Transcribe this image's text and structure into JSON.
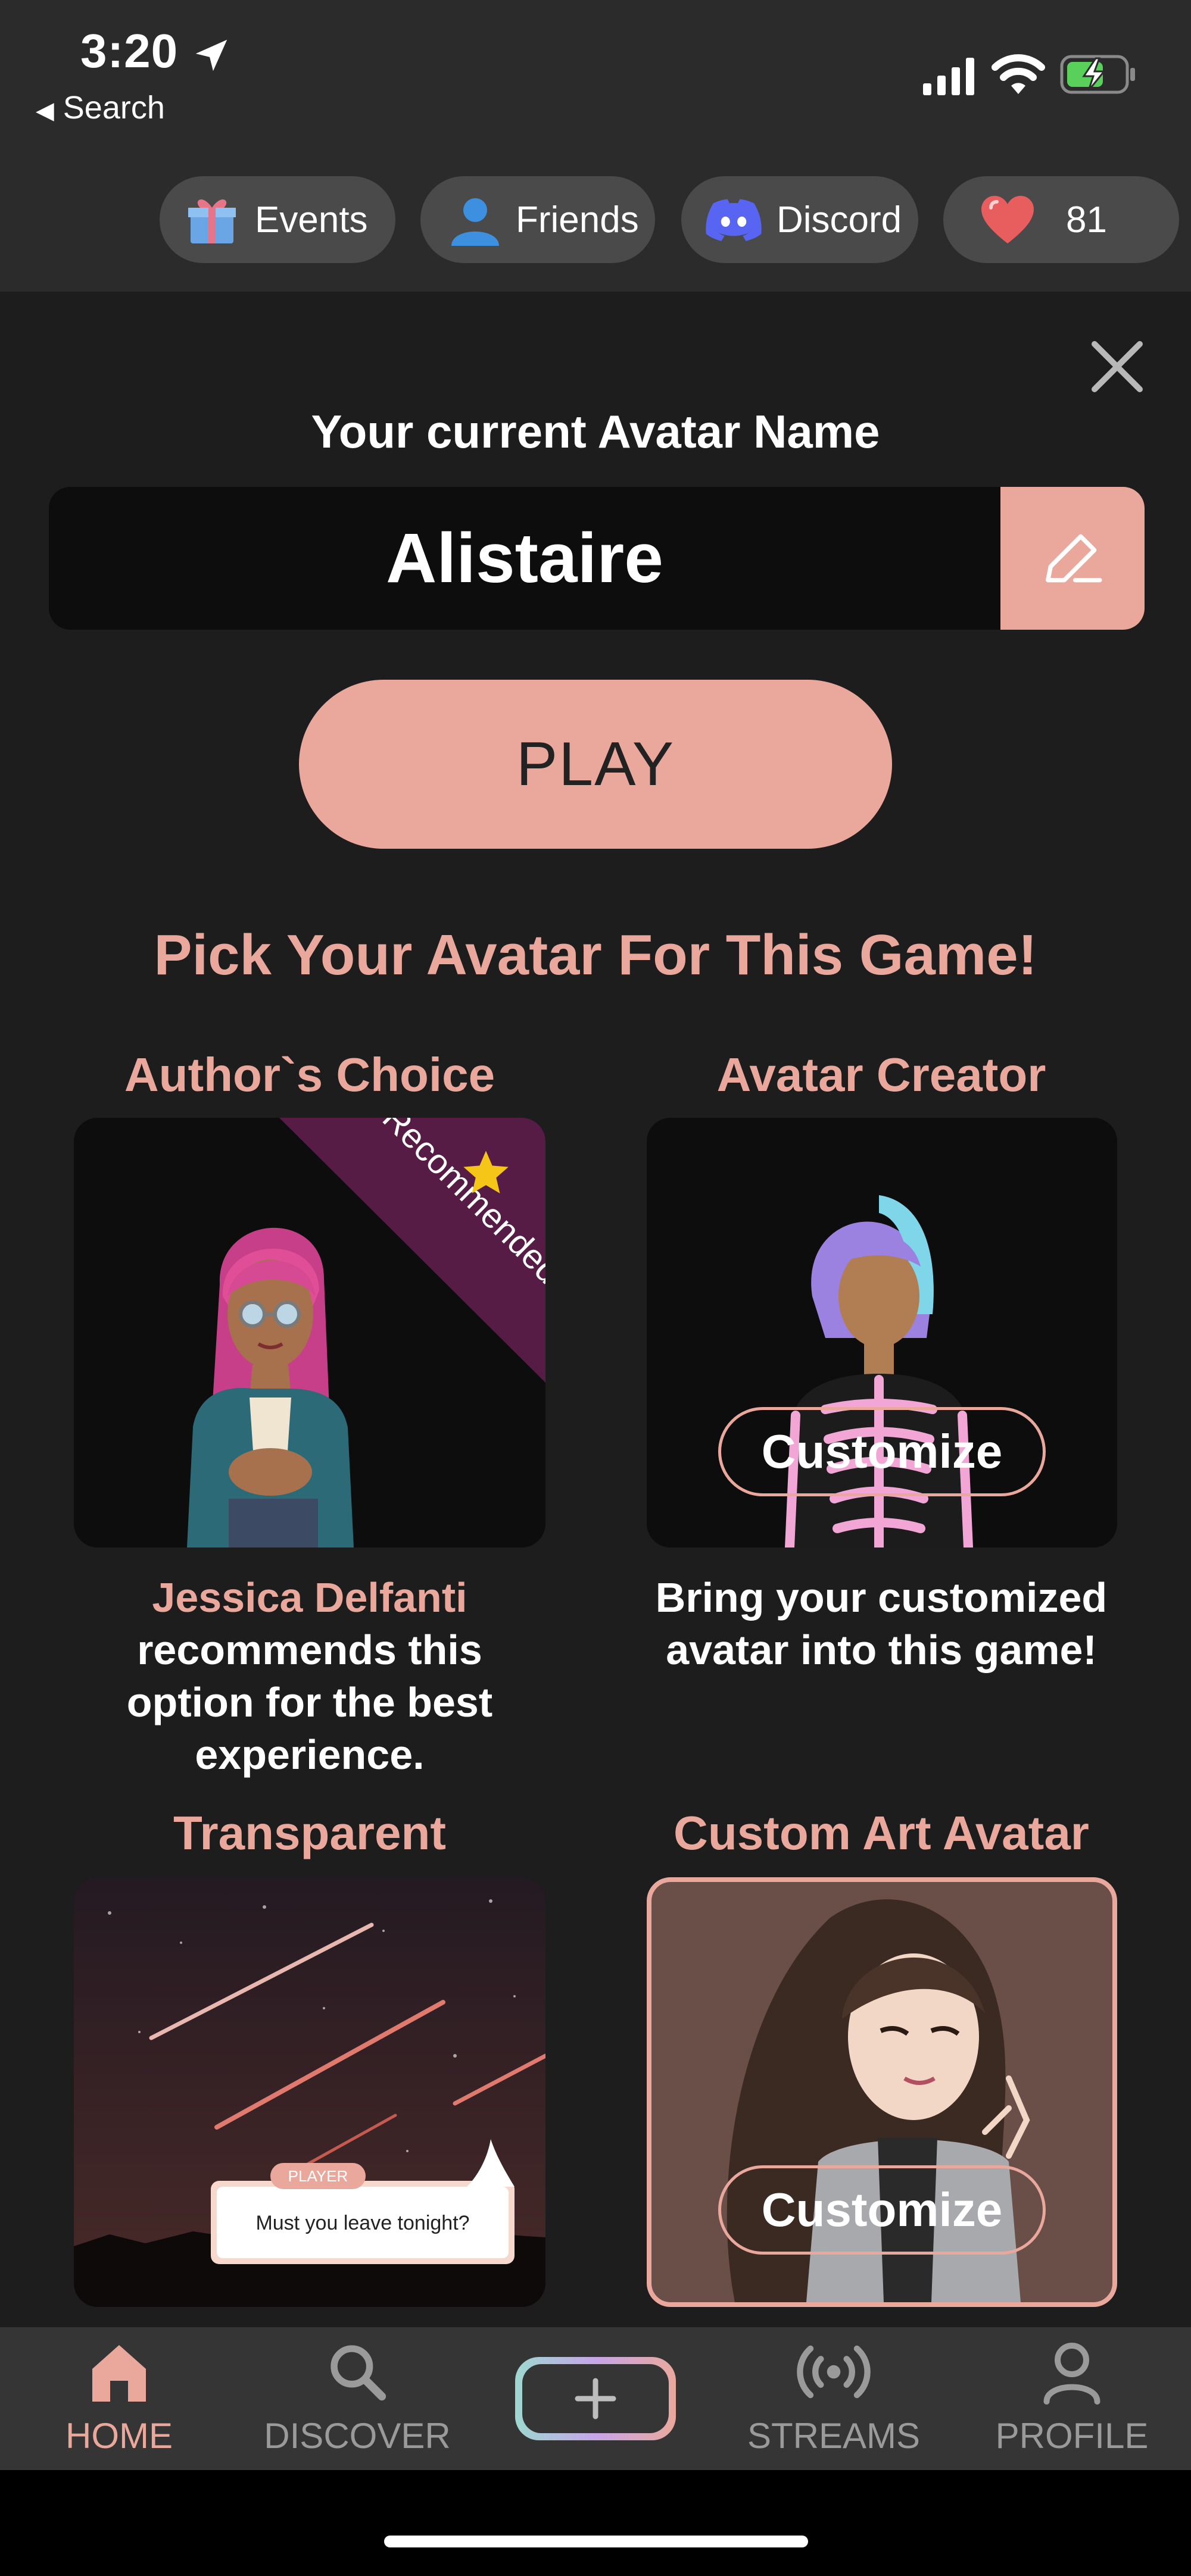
{
  "status": {
    "time": "3:20",
    "back_label": "Search"
  },
  "chips": [
    {
      "label": "Events",
      "icon": "gift-icon"
    },
    {
      "label": "Friends",
      "icon": "person-icon"
    },
    {
      "label": "Discord",
      "icon": "discord-icon"
    },
    {
      "label": "81",
      "icon": "heart-icon"
    }
  ],
  "panel": {
    "title": "Your current Avatar Name",
    "avatar_name": "Alistaire",
    "play_label": "PLAY",
    "pick_heading": "Pick Your Avatar For This Game!"
  },
  "options": {
    "authors_choice": {
      "title": "Author`s Choice",
      "ribbon": "Recommended",
      "author": "Jessica Delfanti",
      "desc": "recommends this option for the best experience."
    },
    "avatar_creator": {
      "title": "Avatar Creator",
      "button": "Customize",
      "desc": "Bring your customized avatar into this game!"
    },
    "transparent": {
      "title": "Transparent",
      "bubble_tag": "PLAYER",
      "bubble_text": "Must you leave tonight?"
    },
    "custom_art": {
      "title": "Custom Art Avatar",
      "button": "Customize"
    }
  },
  "tabs": [
    {
      "label": "HOME",
      "active": true
    },
    {
      "label": "DISCOVER",
      "active": false
    },
    {
      "label": "",
      "active": false
    },
    {
      "label": "STREAMS",
      "active": false
    },
    {
      "label": "PROFILE",
      "active": false
    }
  ],
  "colors": {
    "accent": "#eaa89c",
    "background": "#1d1d1d",
    "ribbon": "#561c46"
  }
}
